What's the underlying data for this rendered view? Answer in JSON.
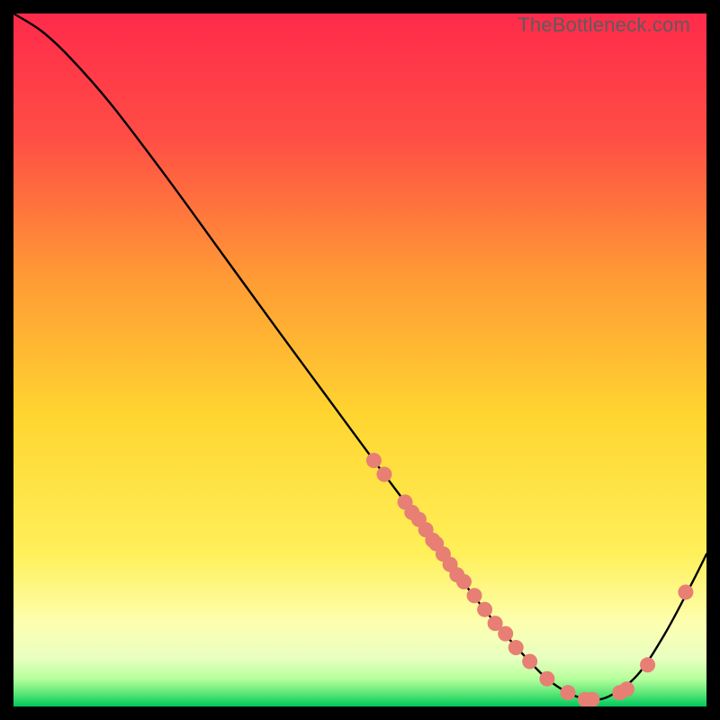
{
  "watermark": "TheBottleneck.com",
  "colors": {
    "gradient_top": "#ff2a4b",
    "gradient_mid_upper": "#ff6a3a",
    "gradient_mid": "#ffd530",
    "gradient_mid_lower": "#fff9b0",
    "gradient_low": "#f6ffd0",
    "gradient_bottom": "#00d060",
    "curve": "#000000",
    "dot": "#e77f74",
    "frame": "#000000"
  },
  "chart_data": {
    "type": "line",
    "title": "",
    "xlabel": "",
    "ylabel": "",
    "xlim": [
      0,
      100
    ],
    "ylim": [
      0,
      100
    ],
    "curve": {
      "x": [
        0,
        4,
        8,
        14,
        22,
        30,
        38,
        45,
        52,
        58,
        62,
        66,
        70,
        74,
        77,
        80,
        83,
        86,
        90,
        94,
        98,
        100
      ],
      "y": [
        100,
        97.5,
        93.8,
        87.0,
        76.5,
        65.5,
        54.5,
        45.0,
        35.5,
        27.5,
        22.0,
        16.5,
        11.5,
        7.0,
        4.0,
        2.0,
        1.0,
        1.5,
        4.5,
        10.5,
        18.0,
        22.0
      ]
    },
    "dots": {
      "x": [
        52,
        53.5,
        56.5,
        57.5,
        58.5,
        59.5,
        60.5,
        61.0,
        62.0,
        63.0,
        64.0,
        65.0,
        66.5,
        68.0,
        69.5,
        71.0,
        72.5,
        74.5,
        77.0,
        80.0,
        82.5,
        83.5,
        87.5,
        88.5,
        91.5,
        97.0
      ],
      "y": [
        35.5,
        33.5,
        29.5,
        28.0,
        27.0,
        25.5,
        24.0,
        23.5,
        22.0,
        20.5,
        19.0,
        18.0,
        16.0,
        14.0,
        12.0,
        10.5,
        8.5,
        6.5,
        4.0,
        2.0,
        1.0,
        1.0,
        2.0,
        2.5,
        6.0,
        16.5
      ]
    }
  }
}
